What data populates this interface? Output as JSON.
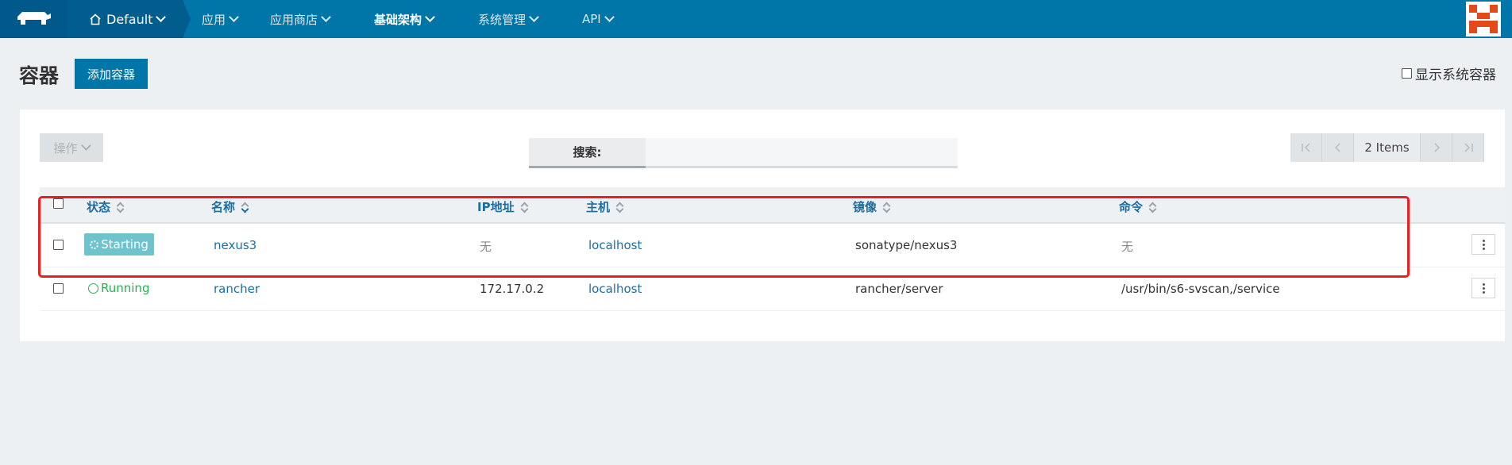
{
  "nav": {
    "logo": "rancher-logo-icon",
    "env_label": "Default",
    "items": [
      {
        "label": "应用"
      },
      {
        "label": "应用商店"
      },
      {
        "label": "基础架构"
      },
      {
        "label": "系统管理"
      },
      {
        "label": "API"
      }
    ]
  },
  "header": {
    "title": "容器",
    "add_button": "添加容器",
    "show_system_label": "显示系统容器"
  },
  "toolbar": {
    "actions_label": "操作",
    "search_label": "搜索:",
    "search_value": "",
    "item_count": "2 Items"
  },
  "table": {
    "columns": [
      "状态",
      "名称",
      "IP地址",
      "主机",
      "镜像",
      "命令"
    ],
    "rows": [
      {
        "state": "Starting",
        "name": "nexus3",
        "ip": "无",
        "host": "localhost",
        "image": "sonatype/nexus3",
        "command": "无"
      },
      {
        "state": "Running",
        "name": "rancher",
        "ip": "172.17.0.2",
        "host": "localhost",
        "image": "rancher/server",
        "command": "/usr/bin/s6-svscan,/service"
      }
    ]
  },
  "colors": {
    "nav_bg": "#0075a8",
    "accent": "#0075a8",
    "starting": "#6fc3cc",
    "running": "#2bae55",
    "highlight": "#e8201f"
  }
}
